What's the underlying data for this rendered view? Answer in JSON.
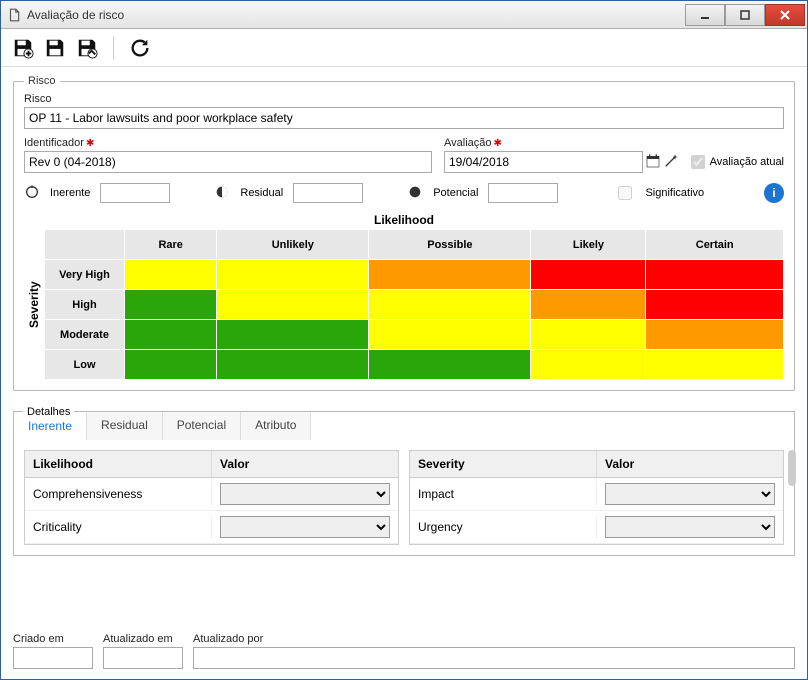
{
  "window": {
    "title": "Avaliação de risco"
  },
  "toolbar": {
    "save_new": "save-new",
    "save": "save",
    "save_close": "save-close",
    "refresh": "refresh"
  },
  "risk": {
    "legend": "Risco",
    "name_label": "Risco",
    "name_value": "OP 11 - Labor lawsuits and poor workplace safety",
    "identifier_label": "Identificador",
    "identifier_value": "Rev 0 (04-2018)",
    "evaluation_label": "Avaliação",
    "evaluation_value": "19/04/2018",
    "current_eval_label": "Avaliação atual",
    "current_eval_checked": true,
    "inherent_label": "Inerente",
    "residual_label": "Residual",
    "potential_label": "Potencial",
    "significant_label": "Significativo",
    "significant_checked": false
  },
  "matrix": {
    "x_title": "Likelihood",
    "y_title": "Severity",
    "columns": [
      "Rare",
      "Unlikely",
      "Possible",
      "Likely",
      "Certain"
    ],
    "rows": [
      "Very High",
      "High",
      "Moderate",
      "Low"
    ],
    "cells": [
      [
        "yellow",
        "yellow",
        "orange",
        "red",
        "red"
      ],
      [
        "green",
        "yellow",
        "yellow",
        "orange",
        "red"
      ],
      [
        "green",
        "green",
        "yellow",
        "yellow",
        "orange"
      ],
      [
        "green",
        "green",
        "green",
        "yellow",
        "yellow"
      ]
    ]
  },
  "details": {
    "legend": "Detalhes",
    "tabs": [
      "Inerente",
      "Residual",
      "Potencial",
      "Atributo"
    ],
    "active_tab": 0,
    "left": {
      "header": [
        "Likelihood",
        "Valor"
      ],
      "rows": [
        "Comprehensiveness",
        "Criticality"
      ]
    },
    "right": {
      "header": [
        "Severity",
        "Valor"
      ],
      "rows": [
        "Impact",
        "Urgency"
      ]
    }
  },
  "footer": {
    "created_label": "Criado em",
    "updated_label": "Atualizado em",
    "updated_by_label": "Atualizado por"
  }
}
